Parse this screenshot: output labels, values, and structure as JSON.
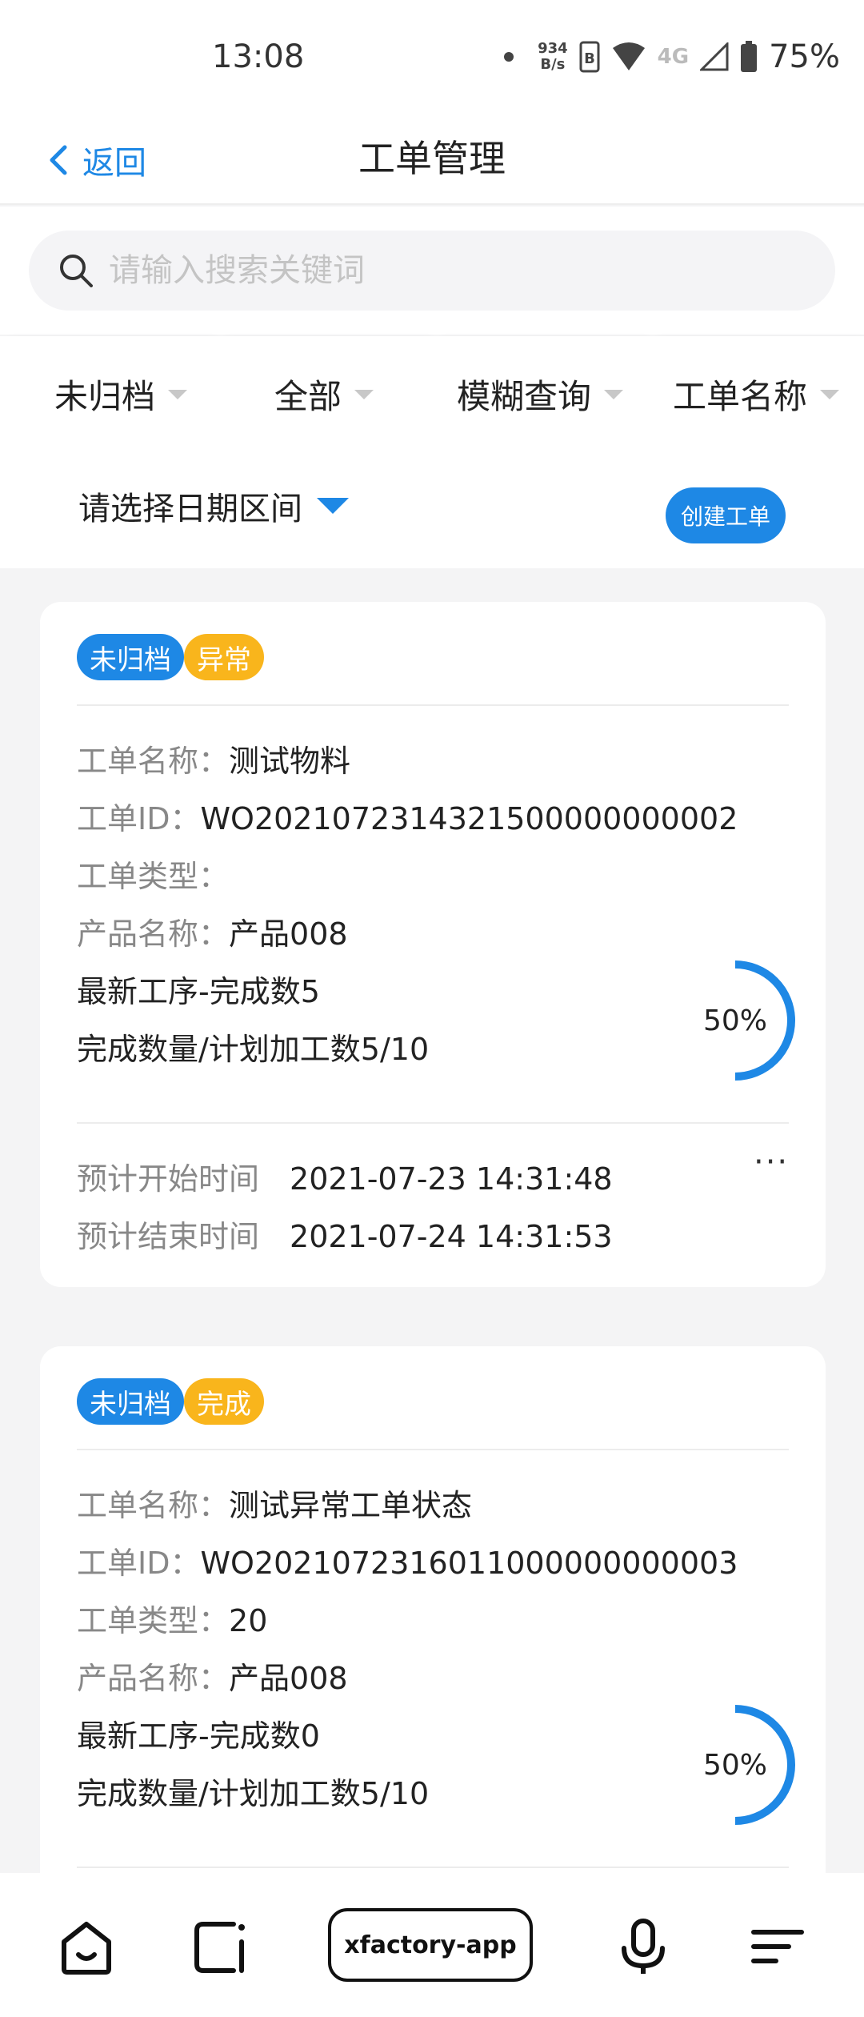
{
  "status_bar": {
    "time": "13:08",
    "net_speed_value": "934",
    "net_speed_unit": "B/s",
    "network_type": "4G",
    "battery": "75%"
  },
  "nav": {
    "back_label": "返回",
    "title": "工单管理"
  },
  "search": {
    "placeholder": "请输入搜索关键词"
  },
  "filters": [
    {
      "label": "未归档"
    },
    {
      "label": "全部"
    },
    {
      "label": "模糊查询"
    },
    {
      "label": "工单名称"
    }
  ],
  "date_range": {
    "placeholder": "请选择日期区间"
  },
  "create_button": "创建工单",
  "orders": [
    {
      "tags": [
        "未归档",
        "异常"
      ],
      "name_label": "工单名称：",
      "name": "测试物料",
      "id_label": "工单ID：",
      "id": "WO2021072314321500000000002",
      "type_label": "工单类型：",
      "type": "",
      "product_label": "产品名称：",
      "product": "产品008",
      "latest_step": "最新工序-完成数5",
      "progress_line": "完成数量/计划加工数5/10",
      "progress_text": "50%",
      "progress_value": 0.5,
      "start_label": "预计开始时间",
      "start_time": "2021-07-23 14:31:48",
      "end_label": "预计结束时间",
      "end_time": "2021-07-24 14:31:53",
      "more": "···"
    },
    {
      "tags": [
        "未归档",
        "完成"
      ],
      "name_label": "工单名称：",
      "name": "测试异常工单状态",
      "id_label": "工单ID：",
      "id": "WO2021072316011000000000003",
      "type_label": "工单类型：",
      "type": "20",
      "product_label": "产品名称：",
      "product": "产品008",
      "latest_step": "最新工序-完成数0",
      "progress_line": "完成数量/计划加工数5/10",
      "progress_text": "50%",
      "progress_value": 0.5
    }
  ],
  "bottom_nav": {
    "app_label": "xfactory-app"
  },
  "colors": {
    "accent": "#1e88e5",
    "warning": "#f9b51c"
  }
}
